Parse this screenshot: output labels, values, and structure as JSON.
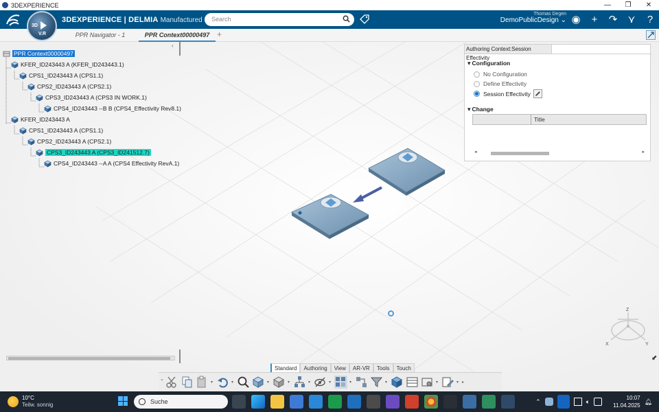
{
  "window": {
    "title": "3DEXPERIENCE",
    "controls": [
      "—",
      "❐",
      "✕"
    ]
  },
  "topbar": {
    "brand_bold": "3DEXPERIENCE | DELMIA",
    "brand_app": "Manufactured Item D...",
    "compass_label": "3D",
    "compass_version": "V.R",
    "search_placeholder": "Search",
    "user_name": "Thomas  Degen",
    "collab_space": "DemoPublicDesign ⌄"
  },
  "tabs": [
    {
      "label": "PPR Navigator - 1",
      "active": false
    },
    {
      "label": "PPR Context00000497",
      "active": true
    }
  ],
  "tab_add": "+",
  "tree": {
    "collapse_symbol": "‹",
    "nodes": [
      {
        "label": "PPR Context00000497",
        "level": 0,
        "selected": "blue"
      },
      {
        "label": "KFER_ID243443 A (KFER_ID243443.1)",
        "level": 1,
        "selected": ""
      },
      {
        "label": "CPS1_ID243443 A (CPS1.1)",
        "level": 2,
        "selected": ""
      },
      {
        "label": "CPS2_ID243443 A (CPS2.1)",
        "level": 3,
        "selected": ""
      },
      {
        "label": "CPS3_ID243443 A (CPS3 IN WORK.1)",
        "level": 4,
        "selected": ""
      },
      {
        "label": "CPS4_ID243443 --B B (CPS4_Effectivity Rev8.1)",
        "level": 5,
        "selected": ""
      },
      {
        "label": "KFER_ID243443 A",
        "level": 1,
        "selected": ""
      },
      {
        "label": "CPS1_ID243443 A (CPS1.1)",
        "level": 2,
        "selected": ""
      },
      {
        "label": "CPS2_ID243443 A (CPS2.1)",
        "level": 3,
        "selected": ""
      },
      {
        "label": "CPS3_ID243443 A (CPS3_ID241512.7)",
        "level": 4,
        "selected": "green"
      },
      {
        "label": "CPS4_ID243443 --A A (CPS4 Effectivity RevA.1)",
        "level": 5,
        "selected": ""
      }
    ]
  },
  "effectivity_panel": {
    "tab": "Authoring Context:Session Effectivity",
    "configuration_heading": "Configuration",
    "options": [
      {
        "label": "No Configuration",
        "checked": false
      },
      {
        "label": "Define Effectivity",
        "checked": false
      },
      {
        "label": "Session Effectivity",
        "checked": true
      }
    ],
    "change_heading": "Change",
    "table_header_title": "Title",
    "scroll_left": "◂",
    "scroll_right": "▸"
  },
  "compass_axes": {
    "z": "Z",
    "x": "X",
    "y": "Y"
  },
  "action_bar": {
    "tabs": [
      {
        "label": "Standard",
        "active": true
      },
      {
        "label": "Authoring",
        "active": false
      },
      {
        "label": "View",
        "active": false
      },
      {
        "label": "AR-VR",
        "active": false
      },
      {
        "label": "Tools",
        "active": false
      },
      {
        "label": "Touch",
        "active": false
      }
    ]
  },
  "taskbar": {
    "weather_temp": "10°C",
    "weather_desc": "Teilw. sonnig",
    "search_placeholder": "Suche",
    "time": "10:07",
    "date": "11.04.2025"
  },
  "colors": {
    "topbar": "#005386",
    "selection_blue": "#1976d2",
    "selection_green": "#1bd8c6",
    "taskbar": "#1c2530"
  }
}
